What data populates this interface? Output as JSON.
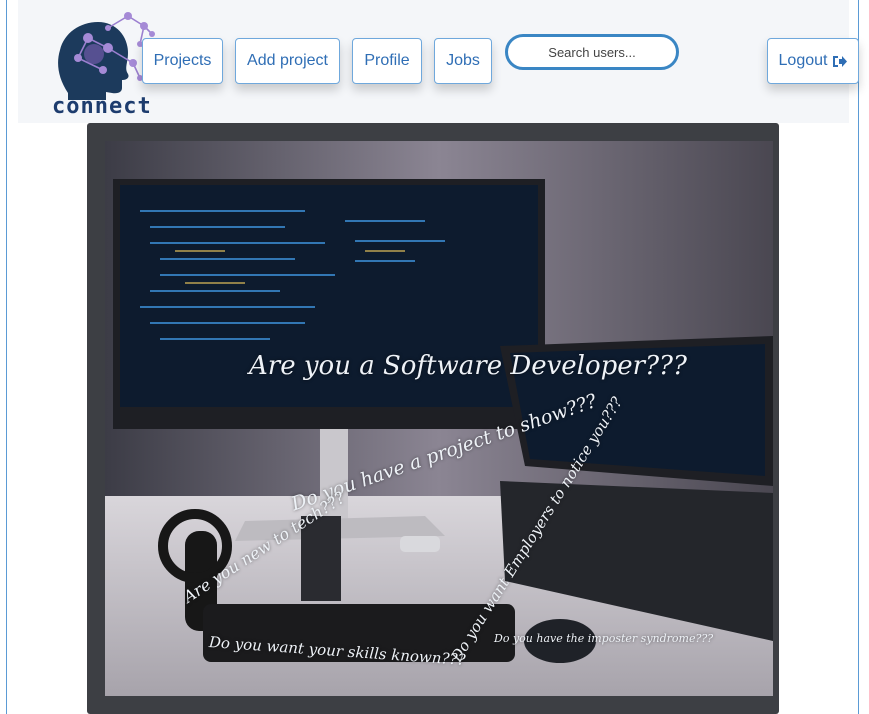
{
  "logo": {
    "text": "connect"
  },
  "nav": {
    "projects_label": "Projects",
    "add_project_label": "Add project",
    "profile_label": "Profile",
    "jobs_label": "Jobs",
    "search_placeholder": "Search users...",
    "logout_label": "Logout",
    "logout_icon": "sign-out-icon"
  },
  "hero": {
    "taglines": [
      "Are you a Software Developer???",
      "Do you have a project to show???",
      "Are you new to tech???",
      "Do you want Employers to notice you???",
      "Do you want your skills known???",
      "Do you have the imposter syndrome???"
    ]
  },
  "colors": {
    "accent": "#2f6eb5",
    "border": "#6fa8dc",
    "navbar_bg": "#f4f6f9",
    "frame_bg": "#3d3f44"
  }
}
